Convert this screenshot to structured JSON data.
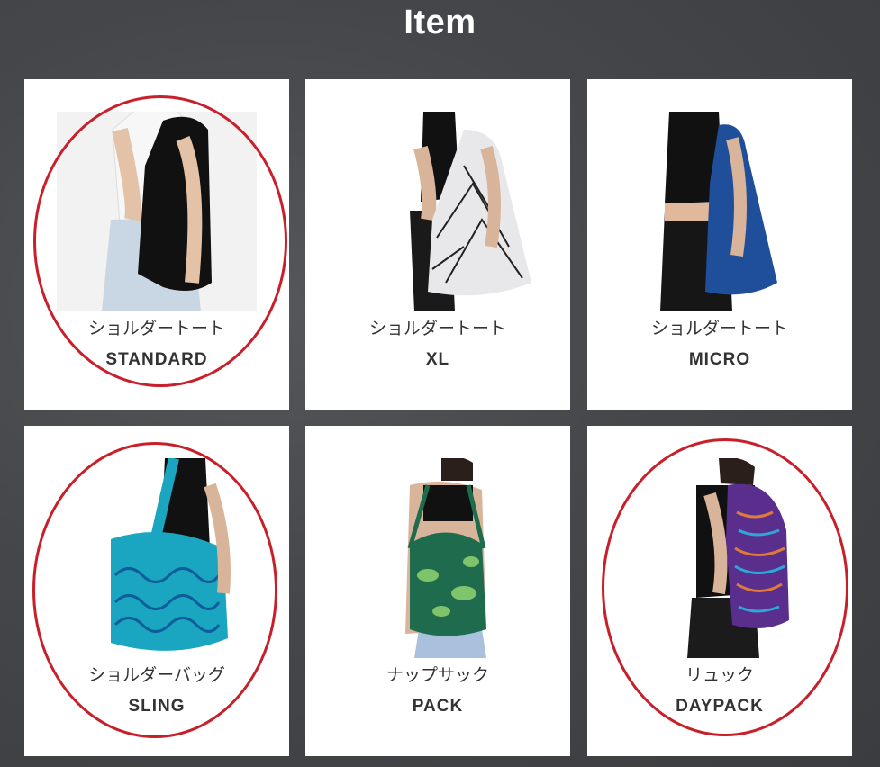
{
  "page": {
    "title": "Item"
  },
  "items": [
    {
      "jp": "ショルダートート",
      "name": "STANDARD",
      "bag_color": "#111111",
      "top_color": "#ffffff",
      "highlighted": true
    },
    {
      "jp": "ショルダートート",
      "name": "XL",
      "bag_color": "#e8e8ea",
      "top_color": "#111111",
      "highlighted": false
    },
    {
      "jp": "ショルダートート",
      "name": "MICRO",
      "bag_color": "#1f4f9a",
      "top_color": "#111111",
      "highlighted": false
    },
    {
      "jp": "ショルダーバッグ",
      "name": "SLING",
      "bag_color": "#1aa6c0",
      "top_color": "#111111",
      "highlighted": true
    },
    {
      "jp": "ナップサック",
      "name": "PACK",
      "bag_color": "#1f6b4e",
      "top_color": "#111111",
      "highlighted": false
    },
    {
      "jp": "リュック",
      "name": "DAYPACK",
      "bag_color": "#5a2e8c",
      "top_color": "#111111",
      "highlighted": true
    }
  ],
  "colors": {
    "highlight_ring": "#c8202a",
    "card_bg": "#ffffff",
    "text": "#333333"
  }
}
